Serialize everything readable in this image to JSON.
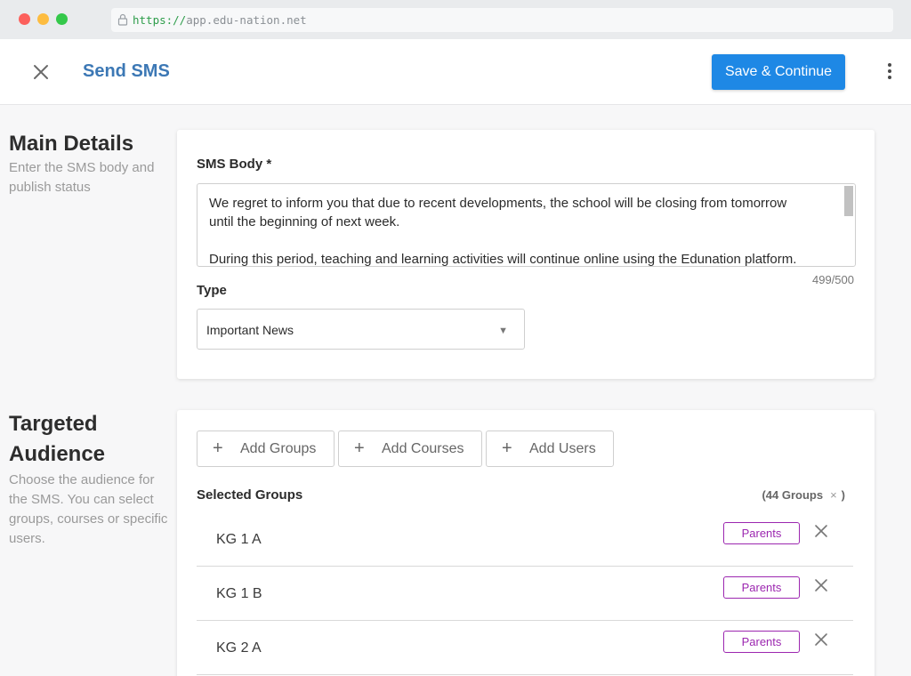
{
  "browser": {
    "url_scheme": "https://",
    "url_rest": "app.edu-nation.net"
  },
  "header": {
    "title": "Send SMS",
    "save_label": "Save & Continue",
    "close_icon": "close-icon",
    "more_icon": "kebab-menu-icon"
  },
  "main_details": {
    "title": "Main Details",
    "description": "Enter the SMS body and publish status",
    "sms_body_label": "SMS Body *",
    "sms_body_line1": "We regret to inform you that due to recent developments, the school will be closing from tomorrow",
    "sms_body_line2": "until the beginning of next week.",
    "sms_body_line3": "During this period, teaching and learning activities will continue online using the Edunation platform.",
    "counter": "499/500",
    "type_label": "Type",
    "type_value": "Important News"
  },
  "audience": {
    "title_line1": "Targeted",
    "title_line2": "Audience",
    "description": "Choose the audience for the SMS. You can select groups, courses or specific users.",
    "add_groups": "Add Groups",
    "add_courses": "Add Courses",
    "add_users": "Add Users",
    "selected_label": "Selected Groups",
    "count_open": "(44 Groups",
    "count_x": "×",
    "count_close": ")",
    "groups": [
      {
        "name": "KG 1 A",
        "role": "Parents"
      },
      {
        "name": "KG 1 B",
        "role": "Parents"
      },
      {
        "name": "KG 2 A",
        "role": "Parents"
      }
    ]
  },
  "colors": {
    "primary": "#1e88e5",
    "title_blue": "#3c78b5",
    "badge_purple": "#9c27b0"
  }
}
